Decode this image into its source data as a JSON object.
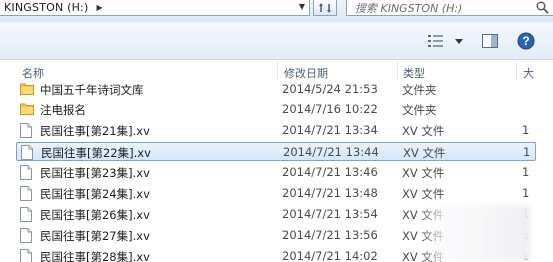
{
  "address": {
    "path": "KINGSTON (H:)"
  },
  "search": {
    "placeholder": "搜索 KINGSTON (H:)"
  },
  "columns": {
    "name": "名称",
    "date": "修改日期",
    "type": "类型",
    "size": "大"
  },
  "files": [
    {
      "name": "中国五千年诗词文库",
      "date": "2014/5/24 21:53",
      "type": "文件夹",
      "size": "",
      "kind": "folder"
    },
    {
      "name": "注电报名",
      "date": "2014/7/16 10:22",
      "type": "文件夹",
      "size": "",
      "kind": "folder"
    },
    {
      "name": "民国往事[第21集].xv",
      "date": "2014/7/21 13:34",
      "type": "XV 文件",
      "size": "1",
      "kind": "file"
    },
    {
      "name": "民国往事[第22集].xv",
      "date": "2014/7/21 13:44",
      "type": "XV 文件",
      "size": "1",
      "kind": "file",
      "selected": true
    },
    {
      "name": "民国往事[第23集].xv",
      "date": "2014/7/21 13:46",
      "type": "XV 文件",
      "size": "1",
      "kind": "file"
    },
    {
      "name": "民国往事[第24集].xv",
      "date": "2014/7/21 13:48",
      "type": "XV 文件",
      "size": "1",
      "kind": "file"
    },
    {
      "name": "民国往事[第26集].xv",
      "date": "2014/7/21 13:54",
      "type": "XV 文件",
      "size": "1",
      "kind": "file"
    },
    {
      "name": "民国往事[第27集].xv",
      "date": "2014/7/21 13:56",
      "type": "XV 文件",
      "size": "1",
      "kind": "file"
    },
    {
      "name": "民国往事[第28集].xv",
      "date": "2014/7/21 14:02",
      "type": "XV 文件",
      "size": "1",
      "kind": "file"
    }
  ]
}
